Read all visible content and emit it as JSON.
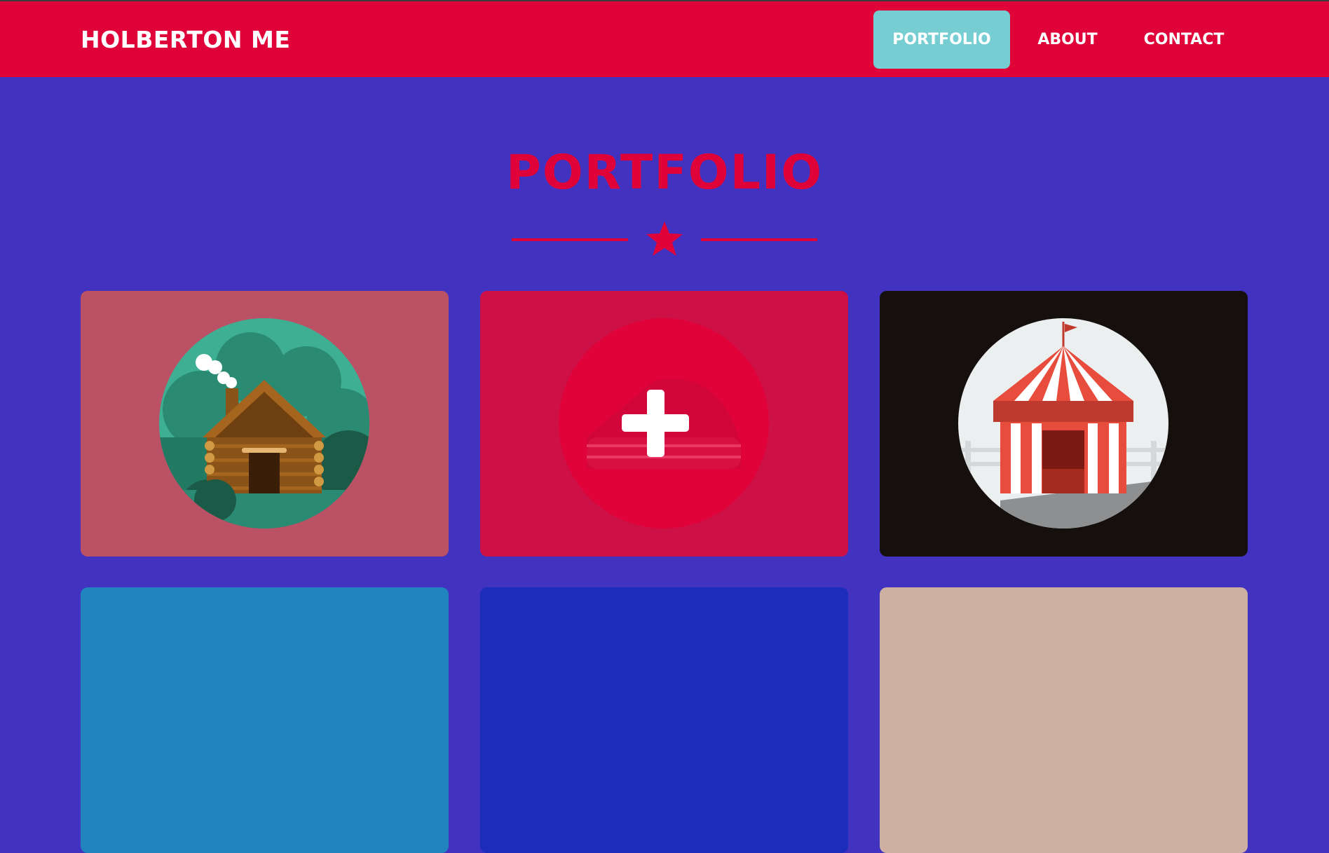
{
  "header": {
    "brand": "HOLBERTON ME",
    "nav": [
      {
        "label": "PORTFOLIO",
        "active": true
      },
      {
        "label": "ABOUT",
        "active": false
      },
      {
        "label": "CONTACT",
        "active": false
      }
    ]
  },
  "main": {
    "title": "PORTFOLIO",
    "divider_icon": "star-icon",
    "items": [
      {
        "icon": "log-cabin-icon",
        "color": "#bb5165"
      },
      {
        "icon": "cake-icon",
        "color": "#cd1147"
      },
      {
        "icon": "circus-tent-icon",
        "color": "#15100e"
      },
      {
        "icon": "",
        "color": "#2184bc"
      },
      {
        "icon": "",
        "color": "#1b2dba"
      },
      {
        "icon": "",
        "color": "#ceb0a3"
      }
    ]
  },
  "colors": {
    "background": "#4232c0",
    "navbar": "#e0033a",
    "accent": "#e0033a",
    "active_nav": "#76cdd2"
  }
}
